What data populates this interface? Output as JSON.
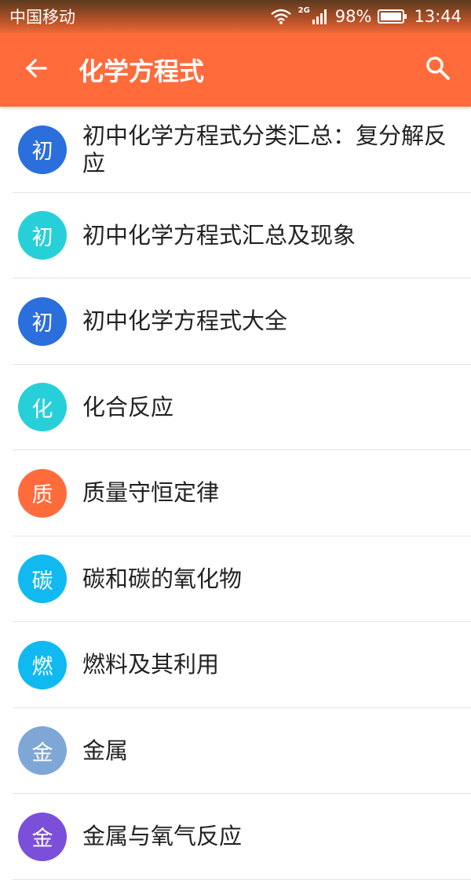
{
  "status_bar": {
    "carrier": "中国移动",
    "network": "2G",
    "battery": "98%",
    "time": "13:44"
  },
  "app_bar": {
    "title": "化学方程式",
    "back_icon": "arrow-left-icon",
    "search_icon": "search-icon"
  },
  "colors": {
    "accent": "#ff6b3b",
    "blue": "#2b6fdc",
    "cyan": "#27d0d8",
    "orange": "#ff6b3b",
    "sky": "#10baf0",
    "slate": "#7fa7d6",
    "purple": "#7b4fd9"
  },
  "items": [
    {
      "avatar": "初",
      "color": "#2b6fdc",
      "label": "初中化学方程式分类汇总：复分解反应"
    },
    {
      "avatar": "初",
      "color": "#27d0d8",
      "label": "初中化学方程式汇总及现象"
    },
    {
      "avatar": "初",
      "color": "#2b6fdc",
      "label": "初中化学方程式大全"
    },
    {
      "avatar": "化",
      "color": "#27d0d8",
      "label": "化合反应"
    },
    {
      "avatar": "质",
      "color": "#ff6b3b",
      "label": "质量守恒定律"
    },
    {
      "avatar": "碳",
      "color": "#10baf0",
      "label": "碳和碳的氧化物"
    },
    {
      "avatar": "燃",
      "color": "#10baf0",
      "label": "燃料及其利用"
    },
    {
      "avatar": "金",
      "color": "#7fa7d6",
      "label": "金属"
    },
    {
      "avatar": "金",
      "color": "#7b4fd9",
      "label": "金属与氧气反应"
    }
  ]
}
